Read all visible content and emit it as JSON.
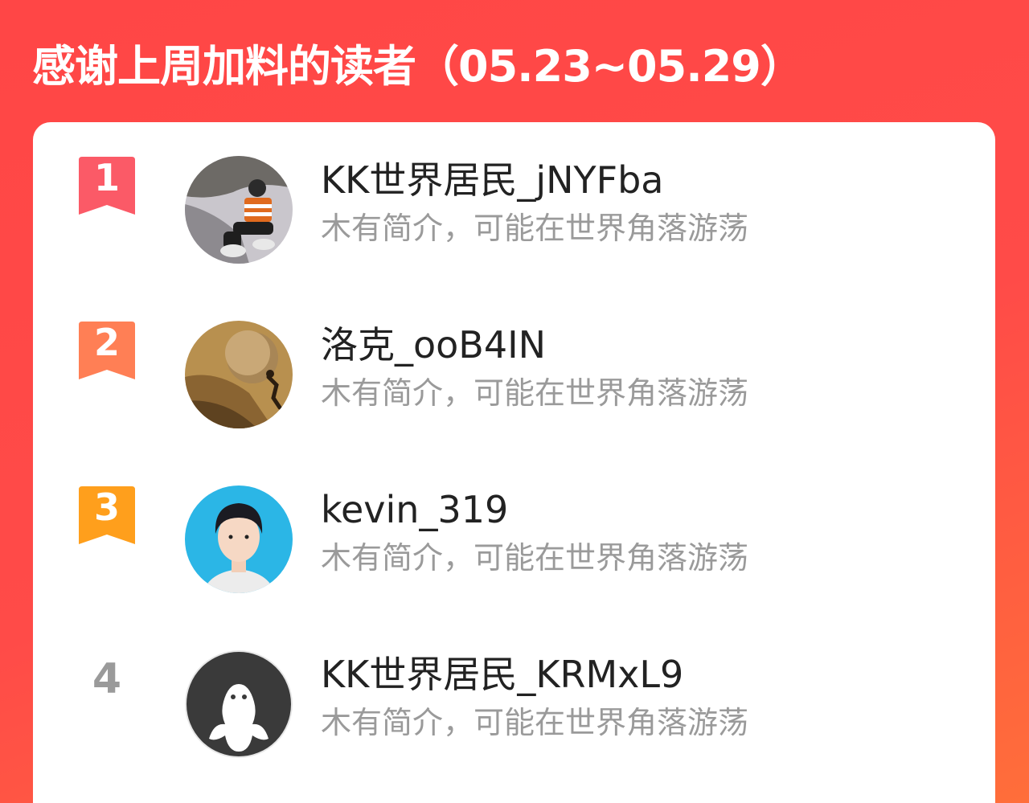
{
  "header": {
    "title": "感谢上周加料的读者（05.23~05.29）"
  },
  "colors": {
    "background_start": "#ff4646",
    "background_end": "#ff6e3a",
    "rank1_badge": "#fb5a67",
    "rank2_badge": "#ff7f55",
    "rank3_badge": "#ff9f1c",
    "rank_plain": "#9a9a9a"
  },
  "readers": [
    {
      "rank": "1",
      "name": "KK世界居民_jNYFba",
      "bio": "木有简介，可能在世界角落游荡",
      "avatar_icon": "photo-person-sitting-roadside"
    },
    {
      "rank": "2",
      "name": "洛克_ooB4IN",
      "bio": "木有简介，可能在世界角落游荡",
      "avatar_icon": "photo-sisyphus-pushing-boulder"
    },
    {
      "rank": "3",
      "name": "kevin_319",
      "bio": "木有简介，可能在世界角落游荡",
      "avatar_icon": "photo-portrait-blue-background"
    },
    {
      "rank": "4",
      "name": "KK世界居民_KRMxL9",
      "bio": "木有简介，可能在世界角落游荡",
      "avatar_icon": "default-avatar-icon"
    }
  ]
}
